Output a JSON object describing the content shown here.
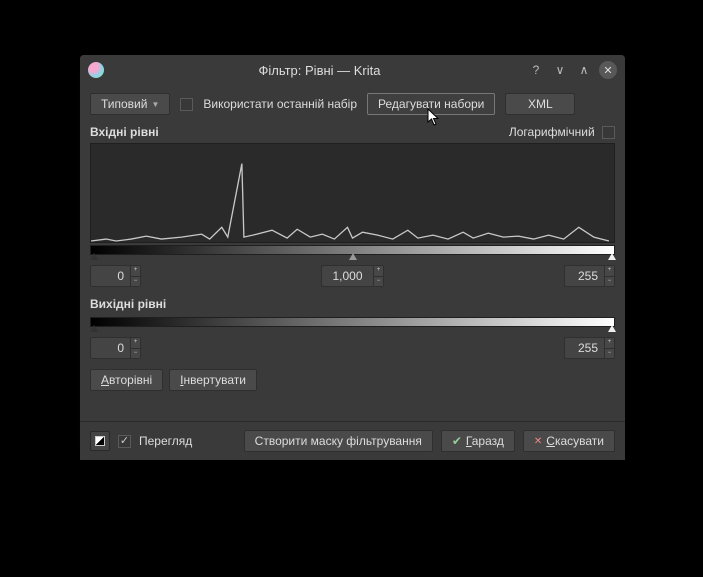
{
  "window": {
    "title": "Фільтр: Рівні — Krita"
  },
  "toolbar": {
    "preset_label": "Типовий",
    "use_last_label": "Використати останній набір",
    "edit_presets_label": "Редагувати набори",
    "xml_label": "XML"
  },
  "input": {
    "title": "Вхідні рівні",
    "log_label": "Логарифмічний",
    "black": "0",
    "gamma": "1,000",
    "white": "255"
  },
  "output": {
    "title": "Вихідні рівні",
    "black": "0",
    "white": "255"
  },
  "actions": {
    "auto_label": "Авторівні",
    "invert_label": "Інвертувати"
  },
  "footer": {
    "preview_label": "Перегляд",
    "create_mask_label": "Створити маску фільтрування",
    "ok_label": "Гаразд",
    "cancel_label": "Скасувати"
  }
}
